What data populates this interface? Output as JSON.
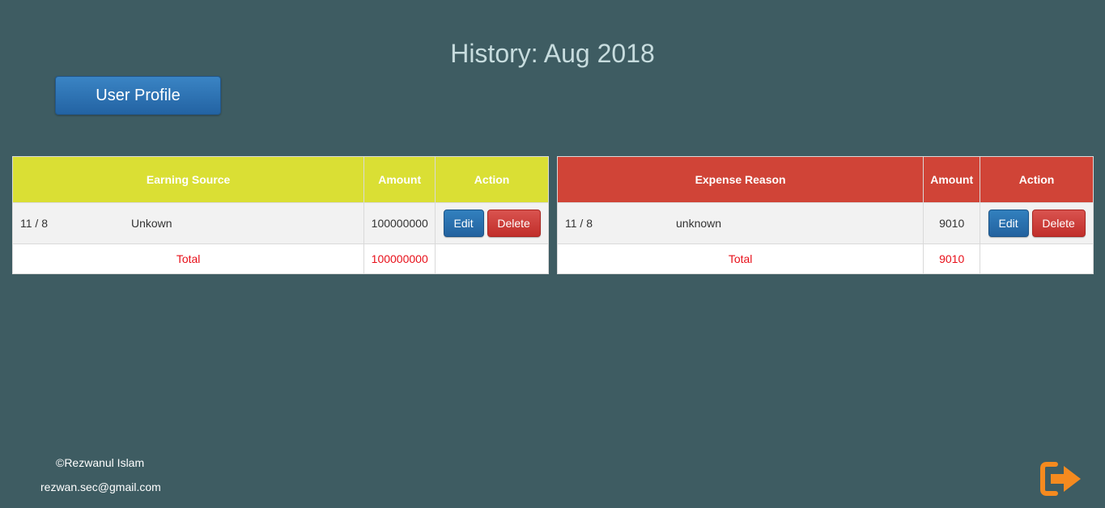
{
  "page": {
    "title": "History: Aug 2018"
  },
  "nav": {
    "profile_button": "User Profile"
  },
  "earnings": {
    "accent": "#dadf34",
    "headers": {
      "source": "Earning Source",
      "amount": "Amount",
      "action": "Action"
    },
    "rows": [
      {
        "date": "11 / 8",
        "source": "Unkown",
        "amount": "100000000",
        "edit_label": "Edit",
        "delete_label": "Delete"
      }
    ],
    "total_label": "Total",
    "total_amount": "100000000"
  },
  "expenses": {
    "accent": "#d04437",
    "headers": {
      "reason": "Expense Reason",
      "amount": "Amount",
      "action": "Action"
    },
    "rows": [
      {
        "date": "11 / 8",
        "reason": "unknown",
        "amount": "9010",
        "edit_label": "Edit",
        "delete_label": "Delete"
      }
    ],
    "total_label": "Total",
    "total_amount": "9010"
  },
  "footer": {
    "copyright": "©Rezwanul Islam",
    "email": "rezwan.sec@gmail.com",
    "logout_icon": "sign-out-icon",
    "logout_color": "#f58a1f"
  }
}
